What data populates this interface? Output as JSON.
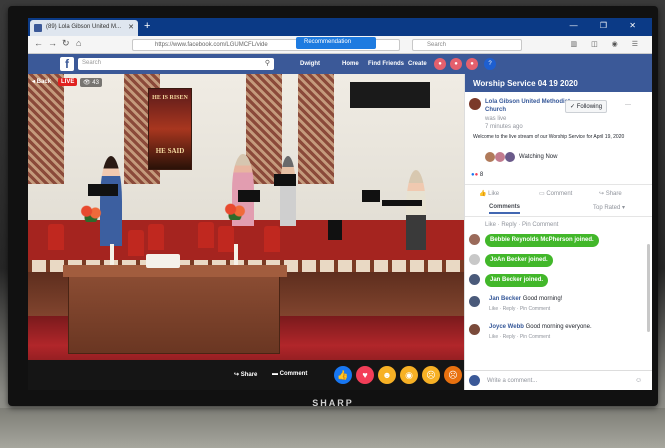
{
  "browser": {
    "tab_title": "(89) Lola Gibson United M...",
    "url": "https://www.facebook.com/LGUMCFL/vide",
    "recommendation_label": "Recommendation",
    "search_placeholder": "Search"
  },
  "facebook": {
    "logo": "f",
    "search_placeholder": "Search",
    "user_name": "Dwight",
    "nav": [
      "Home",
      "Find Friends",
      "Create"
    ]
  },
  "video": {
    "back_label": "Back",
    "live_label": "LIVE",
    "viewer_count": "43",
    "banner_line1": "HE IS RISEN",
    "banner_line2": "HE SAID",
    "share_label": "Share",
    "comment_label": "Comment"
  },
  "sidebar": {
    "title": "Worship Service 04 19 2020",
    "page_name": "Lola Gibson United Methodist Church",
    "was_live": "was live",
    "time_ago": "7 minutes ago",
    "following_label": "Following",
    "description": "Welcome to the live stream of our Worship Service for April 19, 2020",
    "watching_label": "Watching Now",
    "reaction_count": "8",
    "like_label": "Like",
    "comment_label": "Comment",
    "share_label": "Share",
    "comments_tab": "Comments",
    "sort_label": "Top Rated",
    "comment_actions": "Like · Reply · Pin Comment",
    "joins": [
      "Bebbie Reynolds McPherson joined.",
      "JoAn Becker joined.",
      "Jan Becker joined."
    ],
    "comments": [
      {
        "author": "Jan Becker",
        "text": "Good morning!",
        "actions": "Like · Reply · Pin Comment"
      },
      {
        "author": "Joyce Webb",
        "text": "Good morning everyone.",
        "actions": "Like · Reply · Pin Comment"
      }
    ],
    "write_placeholder": "Write a comment..."
  },
  "tv": {
    "brand": "SHARP"
  }
}
